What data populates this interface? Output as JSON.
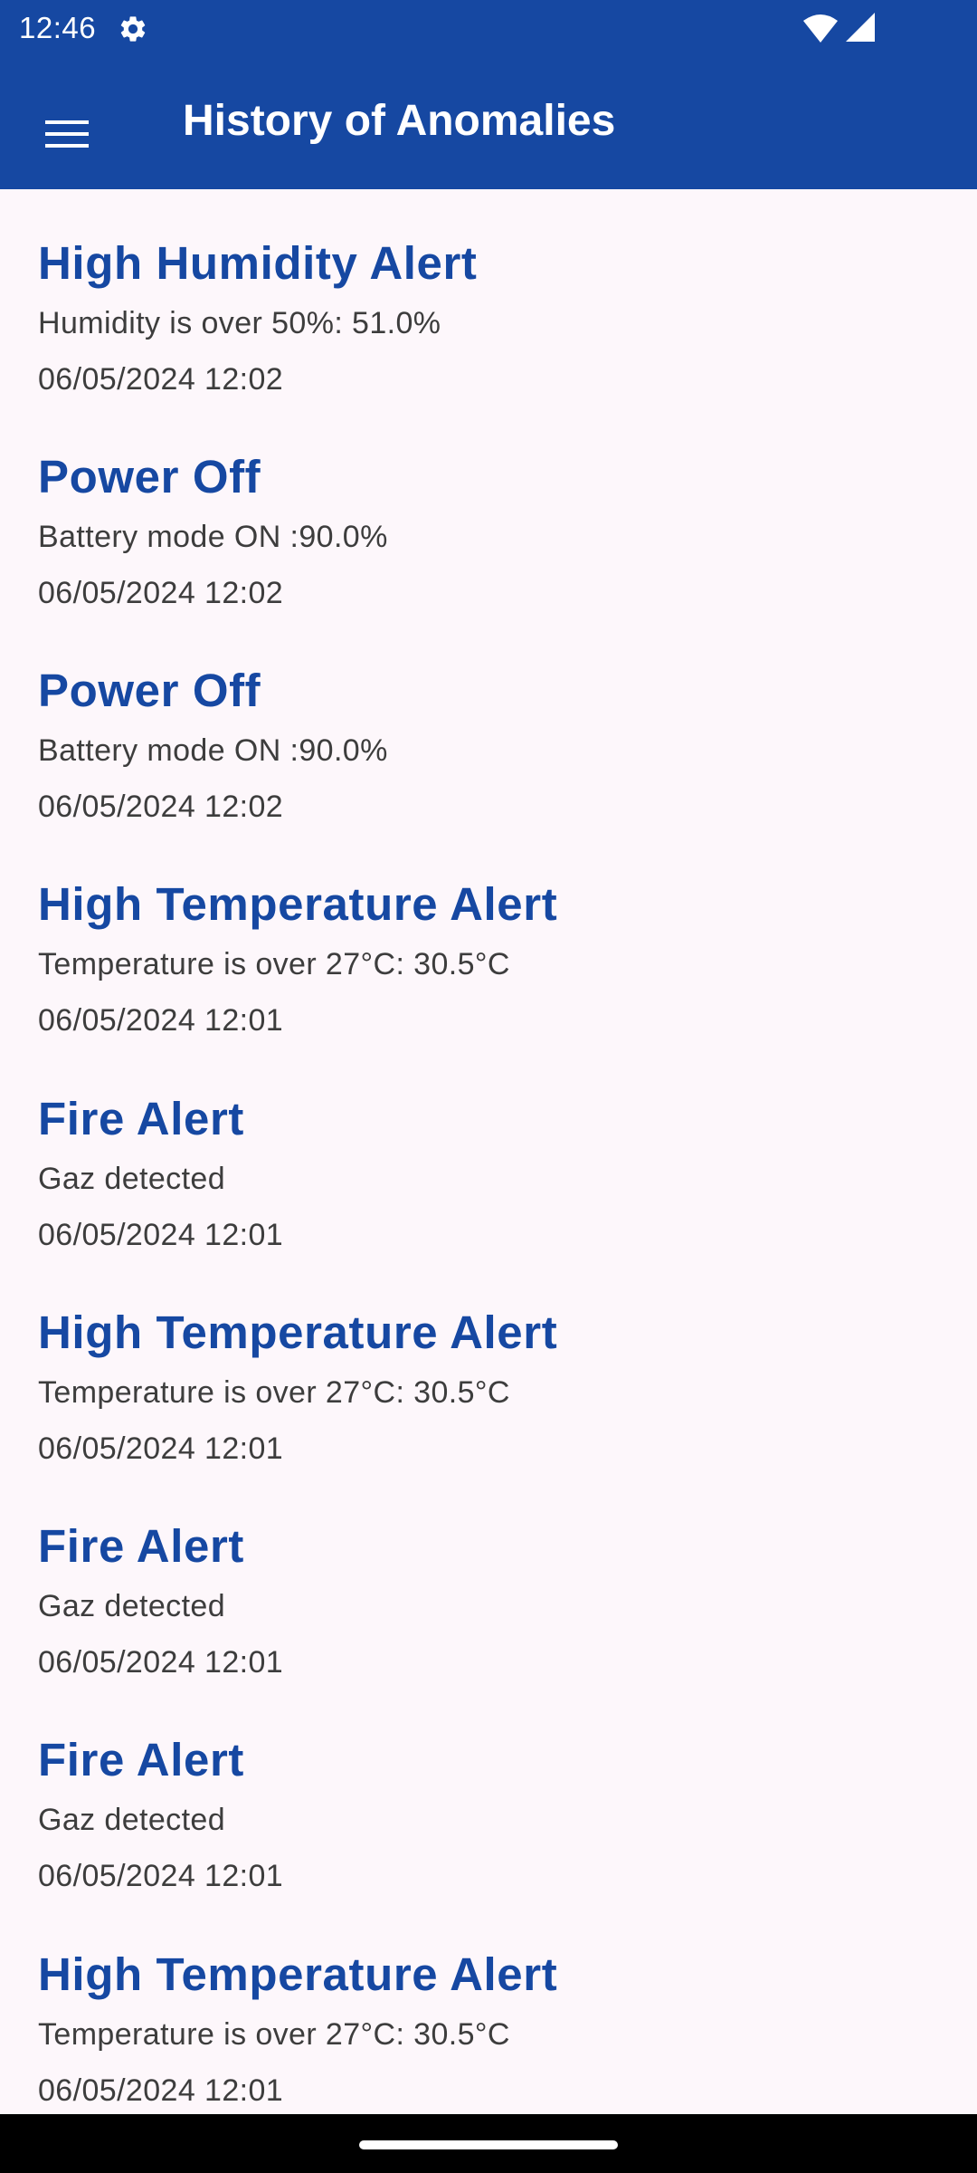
{
  "status_bar": {
    "time": "12:46"
  },
  "app_bar": {
    "title": "History of Anomalies"
  },
  "anomalies": [
    {
      "title": "High Humidity Alert",
      "description": "Humidity is over 50%: 51.0%",
      "date": "06/05/2024 12:02"
    },
    {
      "title": "Power Off",
      "description": "Battery mode ON :90.0%",
      "date": "06/05/2024 12:02"
    },
    {
      "title": "Power Off",
      "description": "Battery mode ON :90.0%",
      "date": "06/05/2024 12:02"
    },
    {
      "title": "High Temperature Alert",
      "description": "Temperature is over 27°C: 30.5°C",
      "date": "06/05/2024 12:01"
    },
    {
      "title": "Fire Alert",
      "description": "Gaz detected",
      "date": "06/05/2024 12:01"
    },
    {
      "title": "High Temperature Alert",
      "description": "Temperature is over 27°C: 30.5°C",
      "date": "06/05/2024 12:01"
    },
    {
      "title": "Fire Alert",
      "description": "Gaz detected",
      "date": "06/05/2024 12:01"
    },
    {
      "title": "Fire Alert",
      "description": "Gaz detected",
      "date": "06/05/2024 12:01"
    },
    {
      "title": "High Temperature Alert",
      "description": "Temperature is over 27°C: 30.5°C",
      "date": "06/05/2024 12:01"
    }
  ],
  "icons": {
    "status_settings": "gear-icon",
    "status_wifi": "wifi-icon",
    "status_signal": "cell-signal-icon",
    "menu": "hamburger-menu-icon"
  },
  "colors": {
    "primary": "#1648a2",
    "background": "#fdf7fb",
    "body_text": "#3d3d3d",
    "on_primary": "#ffffff"
  }
}
